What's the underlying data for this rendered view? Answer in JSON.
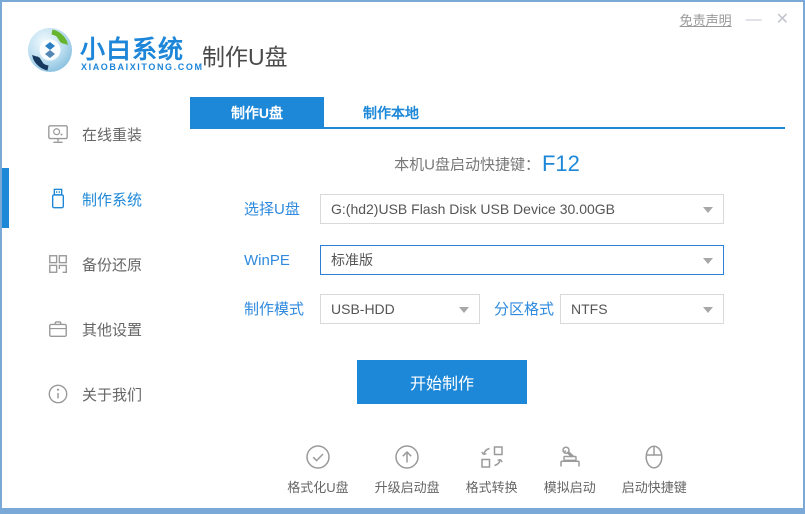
{
  "window": {
    "disclaimer_link": "免责声明",
    "minimize_glyph": "—",
    "close_glyph": "✕"
  },
  "header": {
    "brand_name": "小白系统",
    "brand_domain": "XIAOBAIXITONG.COM",
    "page_title": "制作U盘"
  },
  "sidebar": {
    "items": [
      {
        "label": "在线重装",
        "icon": "monitor-icon",
        "active": false
      },
      {
        "label": "制作系统",
        "icon": "usb-drive-icon",
        "active": true
      },
      {
        "label": "备份还原",
        "icon": "backup-grid-icon",
        "active": false
      },
      {
        "label": "其他设置",
        "icon": "briefcase-icon",
        "active": false
      },
      {
        "label": "关于我们",
        "icon": "info-circle-icon",
        "active": false
      }
    ]
  },
  "tabs": [
    {
      "label": "制作U盘",
      "active": true
    },
    {
      "label": "制作本地",
      "active": false
    }
  ],
  "content": {
    "hotkey_label": "本机U盘启动快捷键：",
    "hotkey_value": "F12",
    "usb_select": {
      "label": "选择U盘",
      "value": "G:(hd2)USB Flash Disk USB Device 30.00GB"
    },
    "winpe_select": {
      "label": "WinPE",
      "value": "标准版"
    },
    "mode_select": {
      "label": "制作模式",
      "value": "USB-HDD"
    },
    "partition_select": {
      "label": "分区格式",
      "value": "NTFS"
    },
    "start_button": "开始制作"
  },
  "footer_tools": [
    {
      "label": "格式化U盘",
      "icon": "check-circle-icon"
    },
    {
      "label": "升级启动盘",
      "icon": "arrow-up-circle-icon"
    },
    {
      "label": "格式转换",
      "icon": "convert-icon"
    },
    {
      "label": "模拟启动",
      "icon": "stamp-icon"
    },
    {
      "label": "启动快捷键",
      "icon": "mouse-icon"
    }
  ],
  "colors": {
    "primary_blue": "#1e88d8",
    "label_blue": "#2e8ade",
    "window_border": "#7aa9d8",
    "input_border": "#d9d9d9",
    "text_dark": "#555555",
    "text_gray": "#888888"
  }
}
